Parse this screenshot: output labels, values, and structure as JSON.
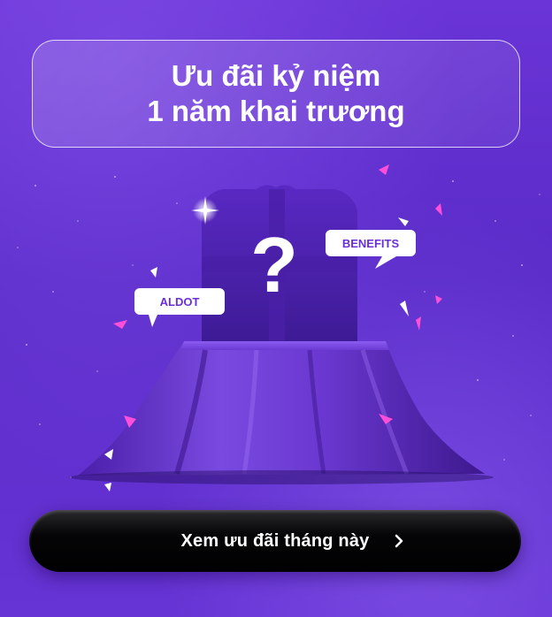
{
  "title": {
    "line1": "Ưu đãi kỷ niệm",
    "line2": "1 năm khai trương"
  },
  "badges": {
    "left": "ALDOT",
    "right": "BENEFITS"
  },
  "mystery_symbol": "?",
  "cta": {
    "label": "Xem ưu đãi tháng này",
    "icon": "chevron-right-icon"
  },
  "colors": {
    "background": "#5a2bc8",
    "badge_text": "#6a2fd8",
    "button": "#000000",
    "confetti": "#ff4fd8"
  }
}
